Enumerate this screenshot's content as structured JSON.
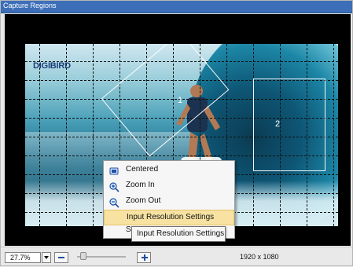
{
  "window": {
    "title": "Capture Regions"
  },
  "canvas": {
    "logo_text": "DIGIBIRD",
    "regions": [
      {
        "label": "1"
      },
      {
        "label": "2"
      }
    ]
  },
  "context_menu": {
    "items": [
      {
        "label": "Centered",
        "icon": "center-icon"
      },
      {
        "label": "Zoom In",
        "icon": "zoom-in-icon"
      },
      {
        "label": "Zoom Out",
        "icon": "zoom-out-icon"
      },
      {
        "label": "Input Resolution Settings",
        "icon": ""
      },
      {
        "label": "Sa",
        "icon": ""
      }
    ],
    "highlighted_index": 3
  },
  "tooltip": {
    "text": "Input Resolution Settings"
  },
  "statusbar": {
    "zoom_value": "27.7%",
    "resolution": "1920 x 1080"
  },
  "colors": {
    "titlebar": "#3d6fb8",
    "menu_highlight": "#f7e2a2",
    "icon_blue": "#1f4ea3"
  }
}
